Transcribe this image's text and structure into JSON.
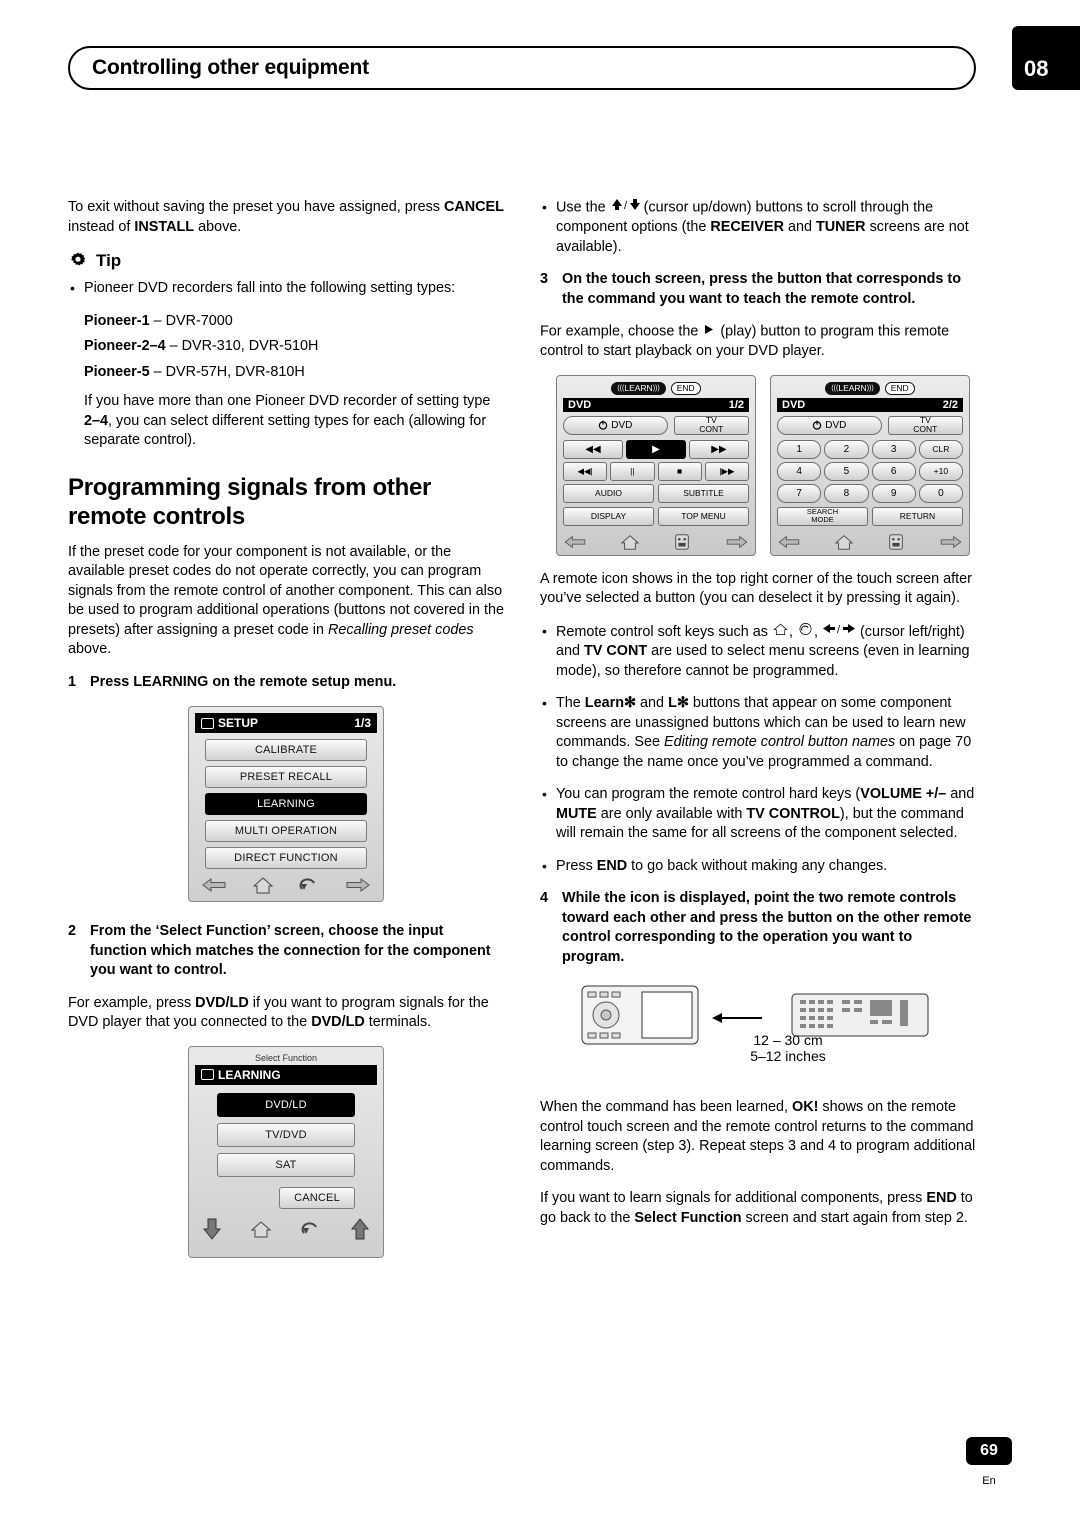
{
  "header": {
    "title": "Controlling other equipment",
    "chapter": "08"
  },
  "footer": {
    "page": "69",
    "lang": "En"
  },
  "left": {
    "intro1": "To exit without saving the preset you have assigned, press CANCEL instead of INSTALL above.",
    "intro1_parts": {
      "a": "To exit without saving the preset you have assigned, press ",
      "b1": "CANCEL",
      "c": " instead of ",
      "b2": "INSTALL",
      "d": " above."
    },
    "tip_label": "Tip",
    "tip_bullet": "Pioneer DVD recorders fall into the following setting types:",
    "types": [
      {
        "name": "Pioneer-1",
        "models": "– DVR-7000"
      },
      {
        "name": "Pioneer-2–4",
        "models": "– DVR-310, DVR-510H"
      },
      {
        "name": "Pioneer-5",
        "models": "– DVR-57H, DVR-810H"
      }
    ],
    "tip_note_a": "If you have more than one Pioneer DVD recorder of setting type ",
    "tip_note_b": "2–4",
    "tip_note_c": ", you can select different setting types for each (allowing for separate control).",
    "section_title": "Programming signals from other remote controls",
    "section_para_a": "If the preset code for your component is not available, or the available preset codes do not operate correctly, you can program signals from the remote control of another component. This can also be used to program additional operations (buttons not covered in the presets) after assigning a preset code in ",
    "section_para_ital": "Recalling preset codes",
    "section_para_b": " above.",
    "step1_num": "1",
    "step1_text": "Press LEARNING on the remote setup menu.",
    "setup_screen": {
      "title": "SETUP",
      "page": "1/3",
      "items": [
        "CALIBRATE",
        "PRESET RECALL",
        "LEARNING",
        "MULTI OPERATION",
        "DIRECT FUNCTION"
      ],
      "selected": "LEARNING"
    },
    "step2_num": "2",
    "step2_text": "From the ‘Select Function’ screen, choose the input function which matches the connection for the component you want to control.",
    "step2_body_a": "For example, press ",
    "step2_body_b": "DVD/LD",
    "step2_body_c": " if you want to program signals for the DVD player that you connected to the ",
    "step2_body_d": "DVD/LD",
    "step2_body_e": " terminals.",
    "learning_screen": {
      "caption": "Select Function",
      "title": "LEARNING",
      "items": [
        "DVD/LD",
        "TV/DVD",
        "SAT"
      ],
      "selected": "DVD/LD",
      "cancel": "CANCEL"
    }
  },
  "right": {
    "bullet_scroll_a": "Use the ",
    "bullet_scroll_b": " (cursor up/down) buttons to scroll through the component options (the ",
    "bullet_scroll_c": "RECEIVER",
    "bullet_scroll_d": " and ",
    "bullet_scroll_e": "TUNER",
    "bullet_scroll_f": " screens are not available).",
    "step3_num": "3",
    "step3_text": "On the touch screen, press the button that corresponds to the command you want to teach the remote control.",
    "step3_body_a": "For example, choose the ",
    "step3_body_b": " (play) button to program this remote control to start playback on your DVD player.",
    "touch1": {
      "learn_label": "LEARN",
      "end_label": "END",
      "title": "DVD",
      "page": "1/2",
      "power_label": "DVD",
      "tv_cont": [
        "TV",
        "CONT"
      ],
      "row1": [
        "◀◀",
        "▶",
        "▶▶"
      ],
      "row2": [
        "◀◀|",
        "||",
        "■",
        "|▶▶"
      ],
      "row3": [
        "AUDIO",
        "SUBTITLE"
      ],
      "row4": [
        "DISPLAY",
        "TOP MENU"
      ]
    },
    "touch2": {
      "learn_label": "LEARN",
      "end_label": "END",
      "title": "DVD",
      "page": "2/2",
      "power_label": "DVD",
      "tv_cont": [
        "TV",
        "CONT"
      ],
      "keys": [
        "1",
        "2",
        "3",
        "CLR",
        "4",
        "5",
        "6",
        "+10",
        "7",
        "8",
        "9",
        "0"
      ],
      "row_bottom": [
        "SEARCH MODE",
        "RETURN"
      ],
      "search_mode_top": "SEARCH",
      "search_mode_bottom": "MODE"
    },
    "after_fig_para": "A remote icon shows in the top right corner of the touch screen after you’ve selected a button (you can deselect it by pressing it again).",
    "bullets": [
      {
        "a": "Remote control soft keys such as ",
        "b": " (cursor left/right) and ",
        "bold": "TV CONT",
        "c": " are used to select menu screens (even in learning mode), so therefore cannot be programmed."
      }
    ],
    "bullet_learn_a": "The ",
    "bullet_learn_b": "Learn✻",
    "bullet_learn_c": " and ",
    "bullet_learn_d": "L✻",
    "bullet_learn_e": " buttons that appear on some component screens are unassigned buttons which can be used to learn new commands. See ",
    "bullet_learn_ital": "Editing remote control button names",
    "bullet_learn_f": " on page 70 to change the name once you’ve programmed a command.",
    "bullet_hard_a": "You can program the remote control hard keys (",
    "bullet_hard_b": "VOLUME +/–",
    "bullet_hard_c": " and ",
    "bullet_hard_d": "MUTE",
    "bullet_hard_e": " are only available with ",
    "bullet_hard_f": "TV CONTROL",
    "bullet_hard_g": "), but the command will remain the same for all screens of the component selected.",
    "bullet_end_a": "Press ",
    "bullet_end_b": "END",
    "bullet_end_c": " to go back without making any changes.",
    "step4_num": "4",
    "step4_text": "While the icon is displayed, point the two remote controls toward each other and press the button on the other remote control corresponding to the operation you want to program.",
    "distance_line1": "12 – 30 cm",
    "distance_line2": "5–12 inches",
    "para_learned_a": "When the command has been learned, ",
    "para_learned_b": "OK!",
    "para_learned_c": " shows on the remote control touch screen and the remote control returns to the command learning screen (step 3). Repeat steps 3 and 4 to program additional commands.",
    "para_last_a": "If you want to learn signals for additional components, press ",
    "para_last_b": "END",
    "para_last_c": " to go back to the ",
    "para_last_d": "Select Function",
    "para_last_e": " screen and start again from step 2."
  }
}
